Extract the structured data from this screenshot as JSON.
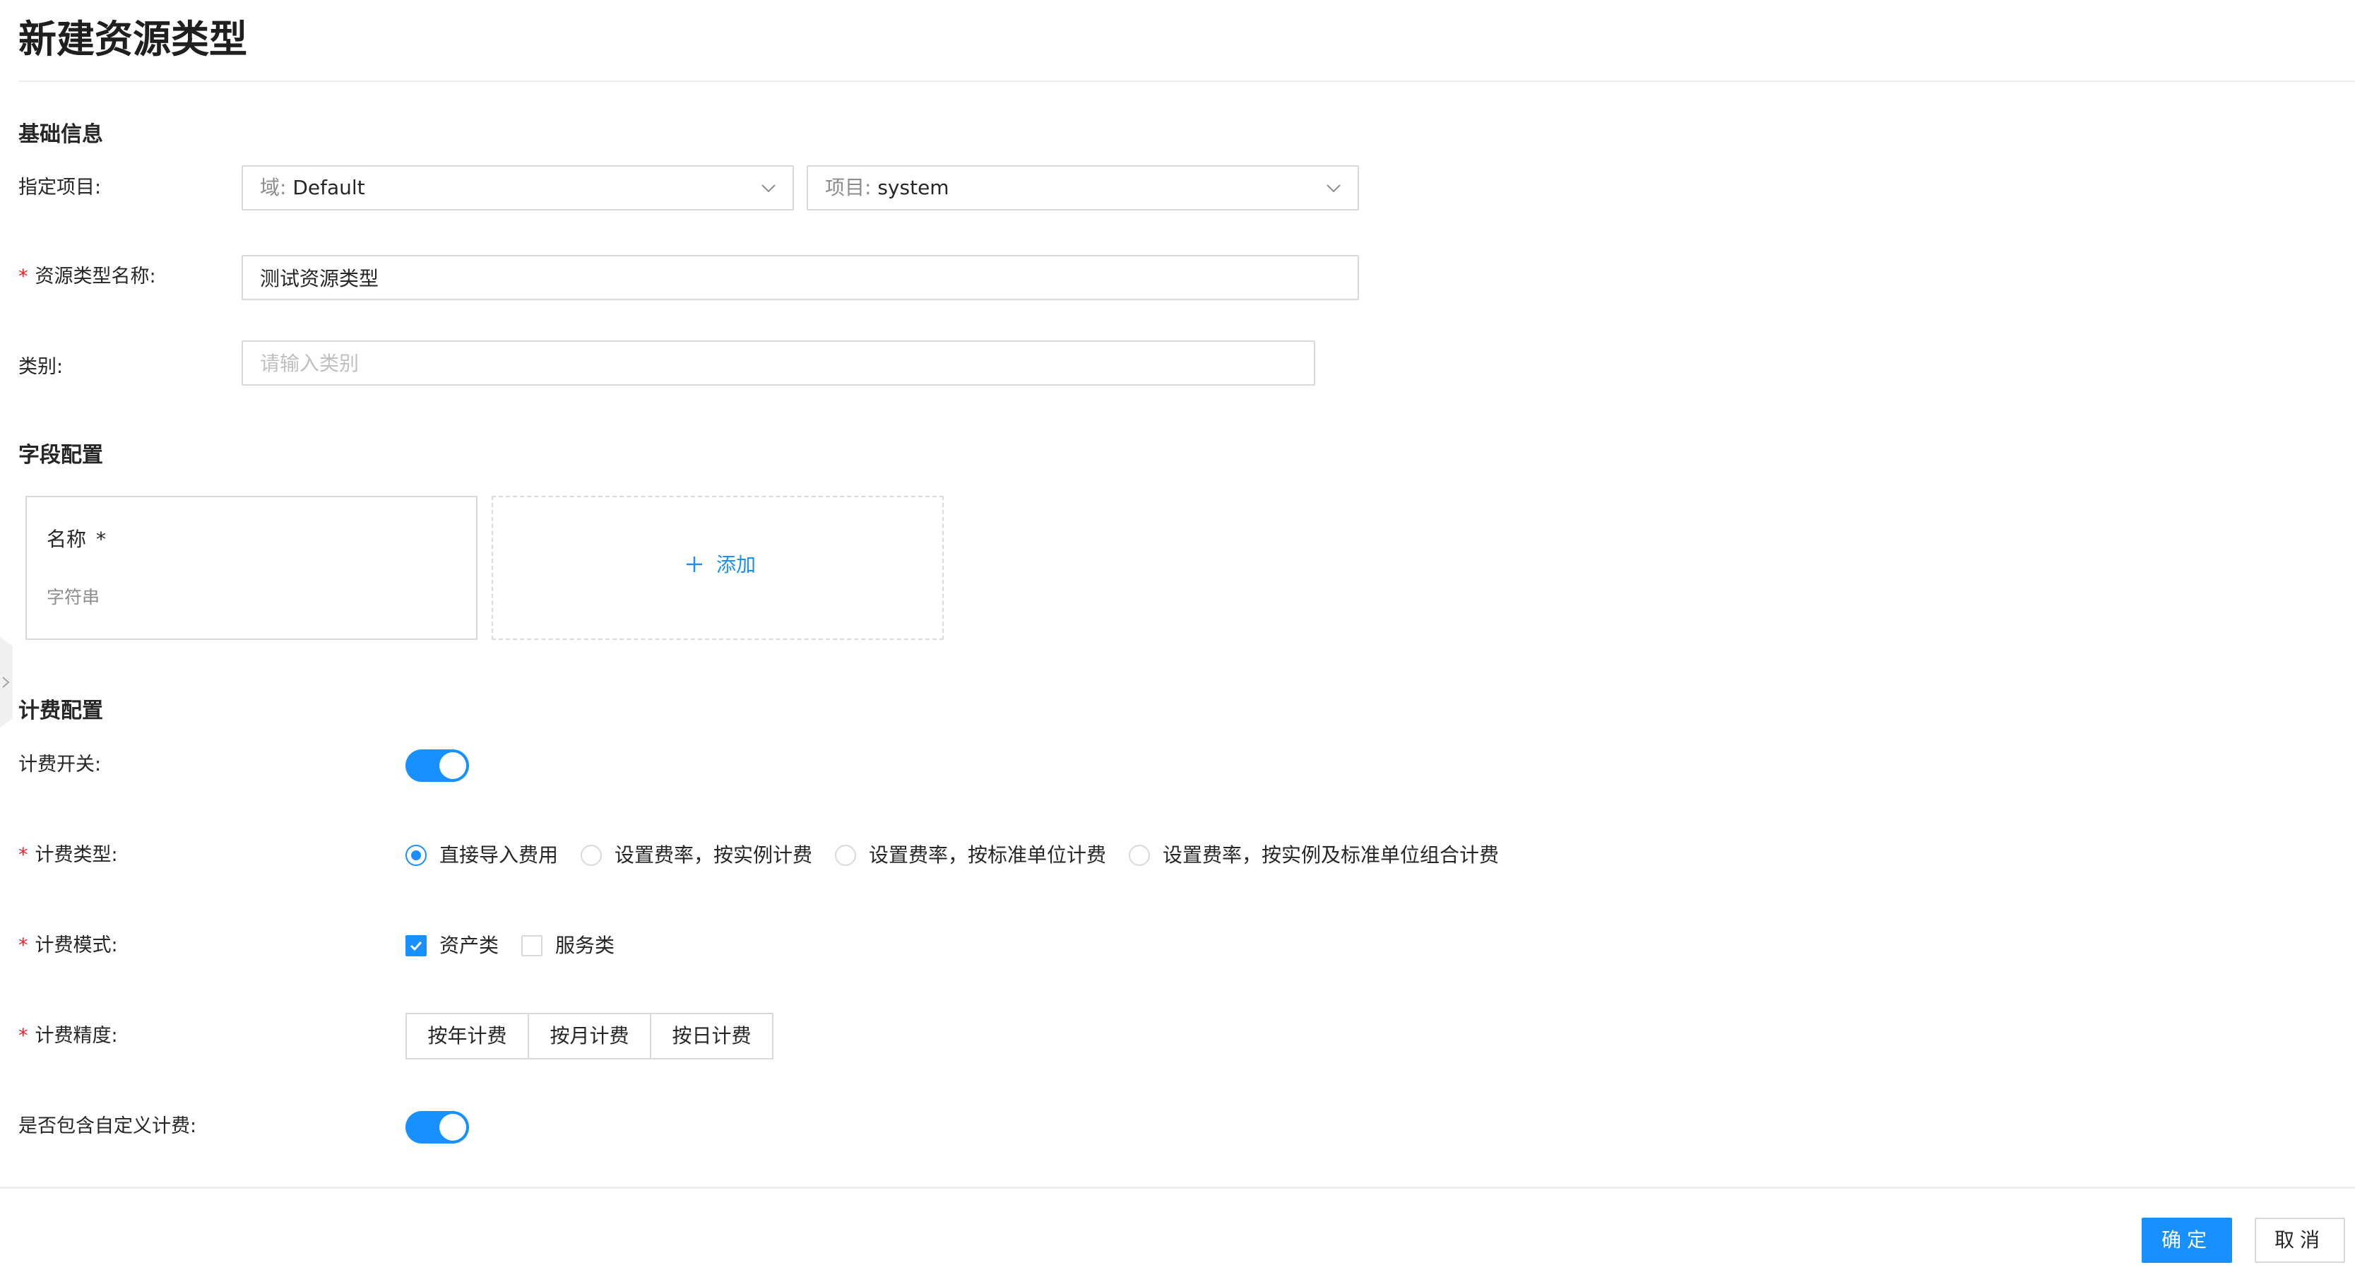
{
  "page": {
    "title": "新建资源类型"
  },
  "sections": {
    "basic": "基础信息",
    "fields": "字段配置",
    "billing": "计费配置"
  },
  "basic": {
    "project_label": "指定项目:",
    "domain_select": {
      "prefix": "域:",
      "value": "Default"
    },
    "project_select": {
      "prefix": "项目:",
      "value": "system"
    },
    "name_required": "*",
    "name_label": "资源类型名称:",
    "name_value": "测试资源类型",
    "category_label": "类别:",
    "category_placeholder": "请输入类别"
  },
  "fields": {
    "cards": [
      {
        "name": "名称",
        "required_mark": "*",
        "type": "字符串"
      }
    ],
    "add_label": "添加"
  },
  "billing": {
    "switch_label": "计费开关:",
    "switch_on": true,
    "type_required": "*",
    "type_label": "计费类型:",
    "type_options": [
      {
        "label": "直接导入费用",
        "checked": true
      },
      {
        "label": "设置费率，按实例计费",
        "checked": false
      },
      {
        "label": "设置费率，按标准单位计费",
        "checked": false
      },
      {
        "label": "设置费率，按实例及标准单位组合计费",
        "checked": false
      }
    ],
    "mode_required": "*",
    "mode_label": "计费模式:",
    "mode_options": [
      {
        "label": "资产类",
        "checked": true
      },
      {
        "label": "服务类",
        "checked": false
      }
    ],
    "precision_required": "*",
    "precision_label": "计费精度:",
    "precision_options": [
      "按年计费",
      "按月计费",
      "按日计费"
    ],
    "custom_label": "是否包含自定义计费:",
    "custom_on": true
  },
  "footer": {
    "confirm": "确定",
    "cancel": "取消"
  },
  "colors": {
    "primary": "#1890ff",
    "required": "#f5222d",
    "border": "#d9d9d9"
  },
  "icons": {
    "select_arrow": "chevron-down-icon",
    "add": "plus-icon",
    "side_handle": "chevron-right-icon",
    "check": "check-icon"
  }
}
